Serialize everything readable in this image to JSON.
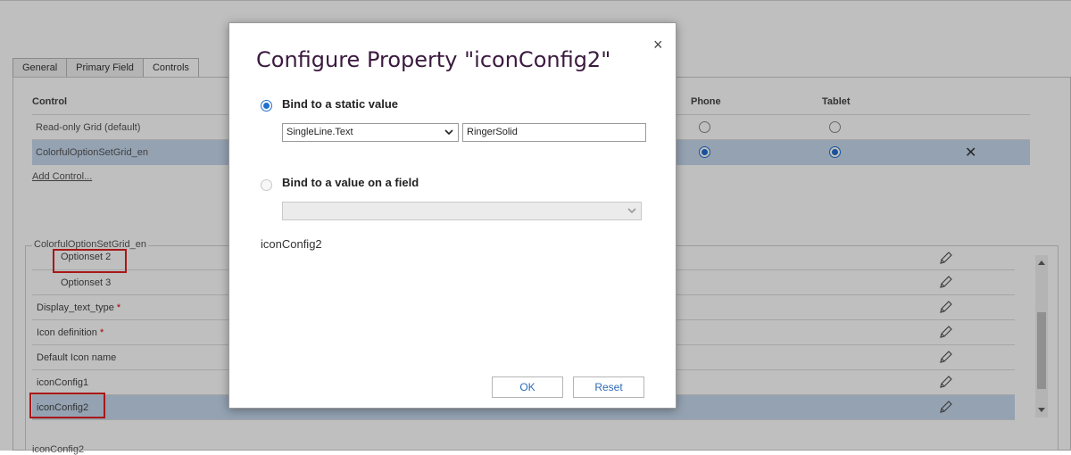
{
  "tabs": [
    "General",
    "Primary Field",
    "Controls"
  ],
  "controls_table": {
    "headers": {
      "control": "Control",
      "phone": "Phone",
      "tablet": "Tablet"
    },
    "rows": [
      {
        "name": "Read-only Grid (default)",
        "phone": false,
        "tablet": false,
        "selected": false
      },
      {
        "name": "ColorfulOptionSetGrid_en",
        "phone": true,
        "tablet": true,
        "selected": true
      }
    ],
    "remove_icon": "close-x-icon",
    "add_link": "Add Control..."
  },
  "properties": {
    "group_title": "ColorfulOptionSetGrid_en",
    "rows": [
      {
        "label": "Optionset 2",
        "required": false,
        "indent": true
      },
      {
        "label": "Optionset 3",
        "required": false,
        "indent": true
      },
      {
        "label": "Display_text_type",
        "required": true,
        "indent": false
      },
      {
        "label": "Icon definition",
        "required": true,
        "indent": false
      },
      {
        "label": "Default Icon name",
        "required": false,
        "indent": false
      },
      {
        "label": "iconConfig1",
        "required": false,
        "indent": false
      },
      {
        "label": "iconConfig2",
        "required": false,
        "indent": false,
        "selected": true
      }
    ],
    "required_marker": "*",
    "edit_icon": "pencil-icon",
    "bottom_text": "iconConfig2"
  },
  "dialog": {
    "title": "Configure Property \"iconConfig2\"",
    "close_label": "×",
    "option_static": "Bind to a static value",
    "static_type": "SingleLine.Text",
    "static_value": "RingerSolid",
    "option_field": "Bind to a value on a field",
    "field_value": "",
    "property_name": "iconConfig2",
    "ok_label": "OK",
    "reset_label": "Reset"
  },
  "colors": {
    "selected_row": "#c6d9ee",
    "accent": "#1f6fd1",
    "annotation": "#e02020",
    "dialog_title": "#3b1a3f"
  }
}
